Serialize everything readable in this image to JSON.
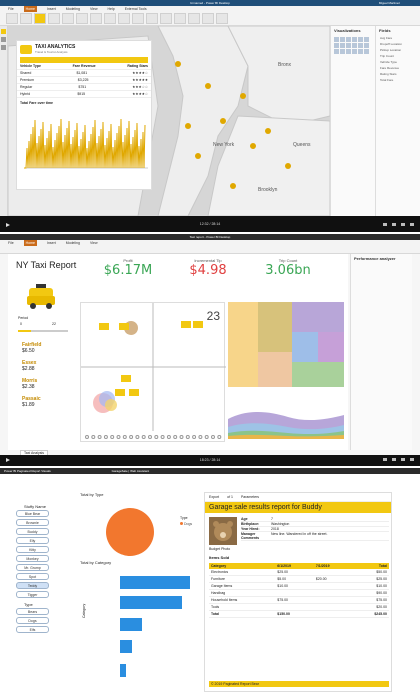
{
  "panel1": {
    "card": {
      "title": "TAXI ANALYTICS",
      "subtitle": "Travel & Tourist Analysis",
      "table_headers": [
        "Vehicle Type",
        "Fare Revenue",
        "Rating Stars"
      ],
      "rows": [
        {
          "type": "Shared",
          "revenue": "$1,081",
          "stars": "★★★★☆"
        },
        {
          "type": "Premium",
          "revenue": "$3,225",
          "stars": "★★★★★"
        },
        {
          "type": "Regular",
          "revenue": "$751",
          "stars": "★★★☆☆"
        },
        {
          "type": "Hybrid",
          "revenue": "$915",
          "stars": "★★★★☆"
        }
      ],
      "chart_title": "Total Fare over time"
    },
    "map_labels": [
      "Bronx",
      "New York",
      "Queens",
      "Brooklyn"
    ],
    "viz_pane_title": "Visualizations",
    "fields_pane_title": "Fields",
    "fields": [
      "Avg Fare",
      "Dropoff Location",
      "Pickup Location",
      "Trip Count",
      "Vehicle Type",
      "Fare Revenue",
      "Rating Stars",
      "Total Fare"
    ],
    "time": "12:32 / 28:14"
  },
  "panel2": {
    "title": "NY Taxi Report",
    "kpis": [
      {
        "label": "Profit",
        "value": "$6.17M",
        "color": "#3aa655"
      },
      {
        "label": "Incremental Tip",
        "value": "$4.98",
        "color": "#e04040"
      },
      {
        "label": "Trip Count",
        "value": "3.06bn",
        "color": "#3aa655"
      }
    ],
    "slider_label": "Period",
    "slider_min": "0",
    "slider_max": "22",
    "slider_value_fraction": 0.25,
    "cities": [
      {
        "name": "Fairfield",
        "value": "$6.50"
      },
      {
        "name": "Essex",
        "value": "$2.88"
      },
      {
        "name": "Morris",
        "value": "$2.38"
      },
      {
        "name": "Passaic",
        "value": "$1.89"
      }
    ],
    "big_number": "23",
    "pane_title": "Performance analyzer",
    "time": "18:23 / 28:14",
    "page_tab": "Taxi Analysis"
  },
  "panel3": {
    "window_title": "Power BI   Paginated Report Visuals",
    "doc_title": "GarageSale | Web Assistant",
    "slicer_title": "Stuffy Name",
    "slicer_items": [
      "Blue Bear",
      "Brownie",
      "Buddy",
      "Elly",
      "Kitty",
      "Monkey",
      "Mr. Grump",
      "Spot",
      "Teddy",
      "Tigger"
    ],
    "selected_item": "Teddy",
    "type_title": "Type",
    "type_items": [
      "Bears",
      "Dogs",
      "Elfs"
    ],
    "pie_title": "Total by Type",
    "pie_legend_title": "Type",
    "pie_legend": "Dogs",
    "bar_title": "Total by Category",
    "bar_axis_title": "Category",
    "report_header": "Garage sale results report for Buddy",
    "page_text": "of 1",
    "params_label": "Parameters",
    "export_label": "Export",
    "photo_label": "Budget Photo",
    "info": [
      {
        "k": "Age",
        "v": "7"
      },
      {
        "k": "Birthplace:",
        "v": "Washington"
      },
      {
        "k": "Year Hired:",
        "v": "2018"
      },
      {
        "k": "Manager Comments",
        "v": "New line. Wandered in off the street."
      }
    ],
    "items_sold": "Items Sold",
    "table_headers": [
      "Category",
      "6/1/2019",
      "7/1/2019",
      "Total"
    ],
    "table_rows": [
      [
        "Electronics",
        "$25.00",
        "",
        "$50.00"
      ],
      [
        "Furniture",
        "$5.00",
        "$20.00",
        "$25.00"
      ],
      [
        "Garage Items",
        "$10.00",
        "",
        "$10.00"
      ],
      [
        "Handbag",
        "",
        "",
        "$90.00"
      ],
      [
        "Household Items",
        "$75.00",
        "",
        "$75.00"
      ],
      [
        "Tools",
        "",
        "",
        "$20.00"
      ]
    ],
    "table_total": [
      "Total",
      "$150.00",
      "",
      "$245.00"
    ],
    "footer": "© 2019 Paginated Report Bear",
    "time": "—"
  }
}
